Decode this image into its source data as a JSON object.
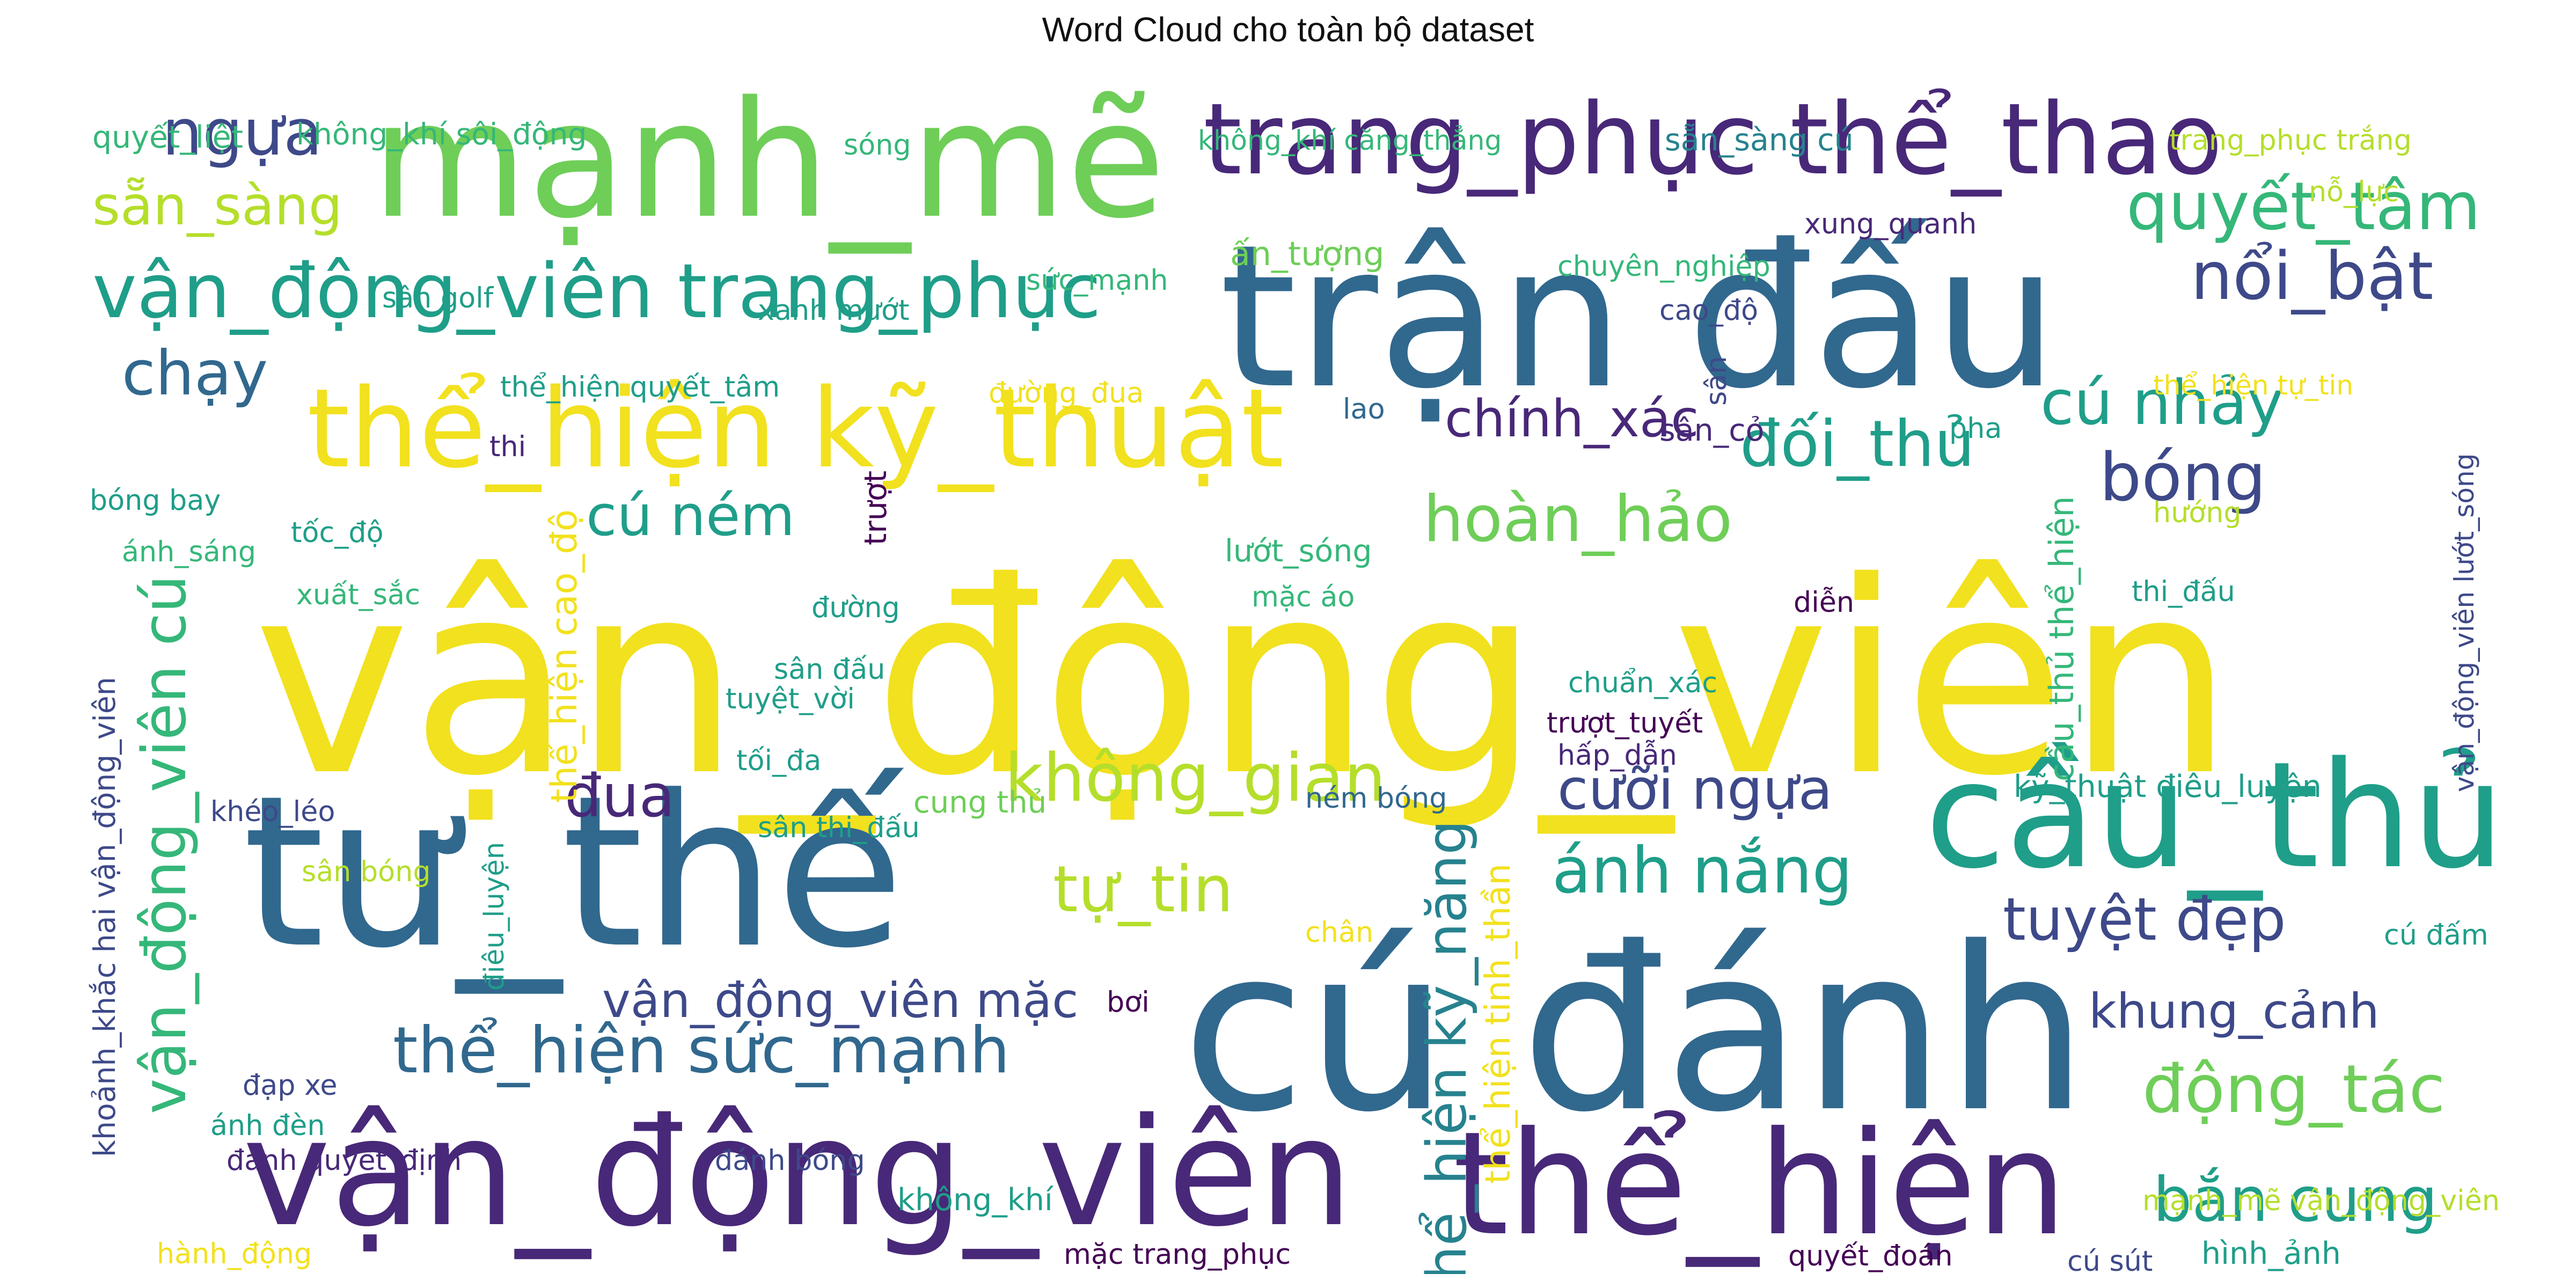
{
  "title": "Word Cloud cho toàn bộ dataset",
  "palette": {
    "yellow": "#f2e11e",
    "yellow_green": "#b5de2b",
    "green": "#6ece58",
    "light_green": "#35b779",
    "teal": "#1f9e89",
    "teal_blue": "#26828e",
    "blue": "#31688e",
    "indigo": "#3e4989",
    "purple": "#482878",
    "dark_purple": "#440154"
  },
  "words": [
    {
      "text": "vận_động_viên",
      "color": "yellow"
    },
    {
      "text": "mạnh_mẽ",
      "color": "green"
    },
    {
      "text": "trận đấu",
      "color": "blue"
    },
    {
      "text": "trang_phục thể_thao",
      "color": "purple"
    },
    {
      "text": "thể_hiện kỹ_thuật",
      "color": "yellow"
    },
    {
      "text": "vận_động_viên trang_phục",
      "color": "teal"
    },
    {
      "text": "tư_thế",
      "color": "blue"
    },
    {
      "text": "cú đánh",
      "color": "blue"
    },
    {
      "text": "cầu_thủ",
      "color": "teal"
    },
    {
      "text": "vận_động_viên",
      "color": "purple"
    },
    {
      "text": "thể_hiện",
      "color": "purple"
    },
    {
      "text": "quyết_tâm",
      "color": "light_green"
    },
    {
      "text": "nổi_bật",
      "color": "indigo"
    },
    {
      "text": "cú nhảy",
      "color": "teal"
    },
    {
      "text": "đối_thủ",
      "color": "teal"
    },
    {
      "text": "bóng",
      "color": "indigo"
    },
    {
      "text": "ngựa",
      "color": "indigo"
    },
    {
      "text": "sẵn_sàng",
      "color": "yellow_green"
    },
    {
      "text": "chạy",
      "color": "blue"
    },
    {
      "text": "cú ném",
      "color": "teal"
    },
    {
      "text": "hoàn_hảo",
      "color": "green"
    },
    {
      "text": "chính_xác",
      "color": "purple"
    },
    {
      "text": "không_gian",
      "color": "yellow_green"
    },
    {
      "text": "đua",
      "color": "purple"
    },
    {
      "text": "tự_tin",
      "color": "yellow_green"
    },
    {
      "text": "cưỡi ngựa",
      "color": "indigo"
    },
    {
      "text": "ánh nắng",
      "color": "teal"
    },
    {
      "text": "tuyệt đẹp",
      "color": "indigo"
    },
    {
      "text": "khung_cảnh",
      "color": "indigo"
    },
    {
      "text": "động_tác",
      "color": "green"
    },
    {
      "text": "bắn cung",
      "color": "teal"
    },
    {
      "text": "vận_động_viên mặc",
      "color": "indigo"
    },
    {
      "text": "thể_hiện sức_mạnh",
      "color": "blue"
    },
    {
      "text": "vận_động_viên cú",
      "color": "light_green"
    },
    {
      "text": "thể_hiện kỹ_năng",
      "color": "teal_blue"
    },
    {
      "text": "quyết_liệt",
      "color": "light_green"
    },
    {
      "text": "không_khí sôi_động",
      "color": "light_green"
    },
    {
      "text": "sóng",
      "color": "light_green"
    },
    {
      "text": "không_khí căng_thẳng",
      "color": "light_green"
    },
    {
      "text": "sẵn_sàng cú",
      "color": "teal_blue"
    },
    {
      "text": "trang_phục trắng",
      "color": "yellow_green"
    },
    {
      "text": "nỗ_lực",
      "color": "yellow_green"
    },
    {
      "text": "xung_quanh",
      "color": "purple"
    },
    {
      "text": "ấn_tượng",
      "color": "green"
    },
    {
      "text": "sức_mạnh",
      "color": "light_green"
    },
    {
      "text": "chuyên_nghiệp",
      "color": "light_green"
    },
    {
      "text": "sân golf",
      "color": "teal"
    },
    {
      "text": "xanh mướt",
      "color": "teal"
    },
    {
      "text": "cao_độ",
      "color": "indigo"
    },
    {
      "text": "thể_hiện quyết_tâm",
      "color": "teal"
    },
    {
      "text": "đường_đua",
      "color": "yellow"
    },
    {
      "text": "lao",
      "color": "blue"
    },
    {
      "text": "sân",
      "color": "indigo"
    },
    {
      "text": "thể_hiện tự_tin",
      "color": "yellow"
    },
    {
      "text": "thi",
      "color": "purple"
    },
    {
      "text": "trượt",
      "color": "dark_purple"
    },
    {
      "text": "sân_cỏ",
      "color": "purple"
    },
    {
      "text": "pha",
      "color": "teal"
    },
    {
      "text": "bóng bay",
      "color": "teal"
    },
    {
      "text": "tốc_độ",
      "color": "teal"
    },
    {
      "text": "lướt_sóng",
      "color": "light_green"
    },
    {
      "text": "hướng",
      "color": "yellow_green"
    },
    {
      "text": "ánh_sáng",
      "color": "light_green"
    },
    {
      "text": "xuất_sắc",
      "color": "light_green"
    },
    {
      "text": "mặc áo",
      "color": "light_green"
    },
    {
      "text": "đường",
      "color": "teal"
    },
    {
      "text": "thi_đấu",
      "color": "teal"
    },
    {
      "text": "diễn",
      "color": "dark_purple"
    },
    {
      "text": "cầu_thủ thể_hiện",
      "color": "light_green"
    },
    {
      "text": "vận_động_viên lướt_sóng",
      "color": "indigo"
    },
    {
      "text": "thể_hiện cao_độ",
      "color": "yellow"
    },
    {
      "text": "sân đấu",
      "color": "teal"
    },
    {
      "text": "tuyệt_vời",
      "color": "teal"
    },
    {
      "text": "chuẩn_xác",
      "color": "teal"
    },
    {
      "text": "trượt_tuyết",
      "color": "dark_purple"
    },
    {
      "text": "hấp_dẫn",
      "color": "purple"
    },
    {
      "text": "tối_đa",
      "color": "teal"
    },
    {
      "text": "khoảnh_khắc hai vận_động_viên",
      "color": "indigo"
    },
    {
      "text": "khéo_léo",
      "color": "indigo"
    },
    {
      "text": "cung thủ",
      "color": "green"
    },
    {
      "text": "ném bóng",
      "color": "blue"
    },
    {
      "text": "kỹ_thuật điêu_luyện",
      "color": "teal"
    },
    {
      "text": "sân thi_đấu",
      "color": "teal"
    },
    {
      "text": "điêu_luyện",
      "color": "teal"
    },
    {
      "text": "sân bóng",
      "color": "yellow_green"
    },
    {
      "text": "thể_hiện tinh_thần",
      "color": "yellow"
    },
    {
      "text": "chân",
      "color": "yellow"
    },
    {
      "text": "cú đấm",
      "color": "teal"
    },
    {
      "text": "bơi",
      "color": "dark_purple"
    },
    {
      "text": "đạp xe",
      "color": "indigo"
    },
    {
      "text": "ánh đèn",
      "color": "teal"
    },
    {
      "text": "đánh quyết_định",
      "color": "purple"
    },
    {
      "text": "đánh bóng",
      "color": "indigo"
    },
    {
      "text": "không_khí",
      "color": "teal"
    },
    {
      "text": "mạnh_mẽ vận_động_viên",
      "color": "yellow_green"
    },
    {
      "text": "hành_động",
      "color": "yellow"
    },
    {
      "text": "mặc trang_phục",
      "color": "dark_purple"
    },
    {
      "text": "quyết_đoán",
      "color": "dark_purple"
    },
    {
      "text": "cú sút",
      "color": "indigo"
    },
    {
      "text": "hình_ảnh",
      "color": "teal"
    }
  ]
}
